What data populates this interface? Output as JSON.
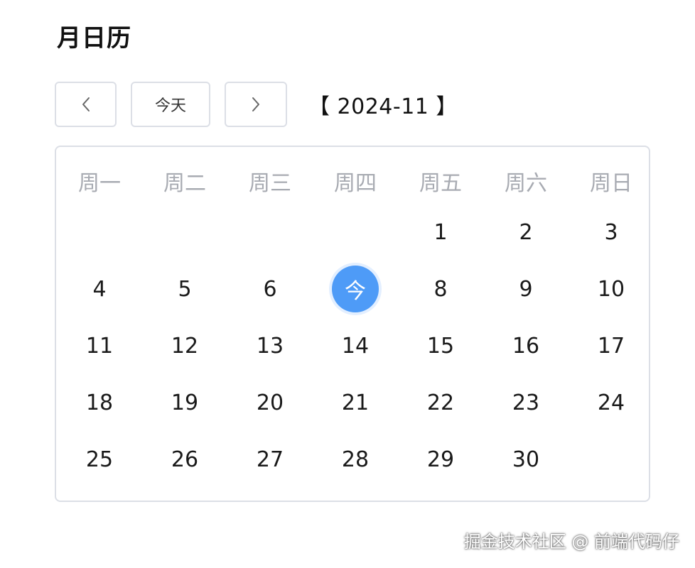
{
  "page": {
    "title": "月日历"
  },
  "toolbar": {
    "prev_icon": "chevron-left-icon",
    "today_label": "今天",
    "next_icon": "chevron-right-icon",
    "month_label": "【 2024-11 】"
  },
  "calendar": {
    "weekdays": [
      "周一",
      "周二",
      "周三",
      "周四",
      "周五",
      "周六",
      "周日"
    ],
    "days": [
      "",
      "",
      "",
      "",
      "1",
      "2",
      "3",
      "4",
      "5",
      "6",
      "今",
      "8",
      "9",
      "10",
      "11",
      "12",
      "13",
      "14",
      "15",
      "16",
      "17",
      "18",
      "19",
      "20",
      "21",
      "22",
      "23",
      "24",
      "25",
      "26",
      "27",
      "28",
      "29",
      "30",
      ""
    ],
    "today_marker": "今",
    "accent_color": "#4e9bf7"
  },
  "watermark": "掘金技术社区 @ 前端代码仔"
}
